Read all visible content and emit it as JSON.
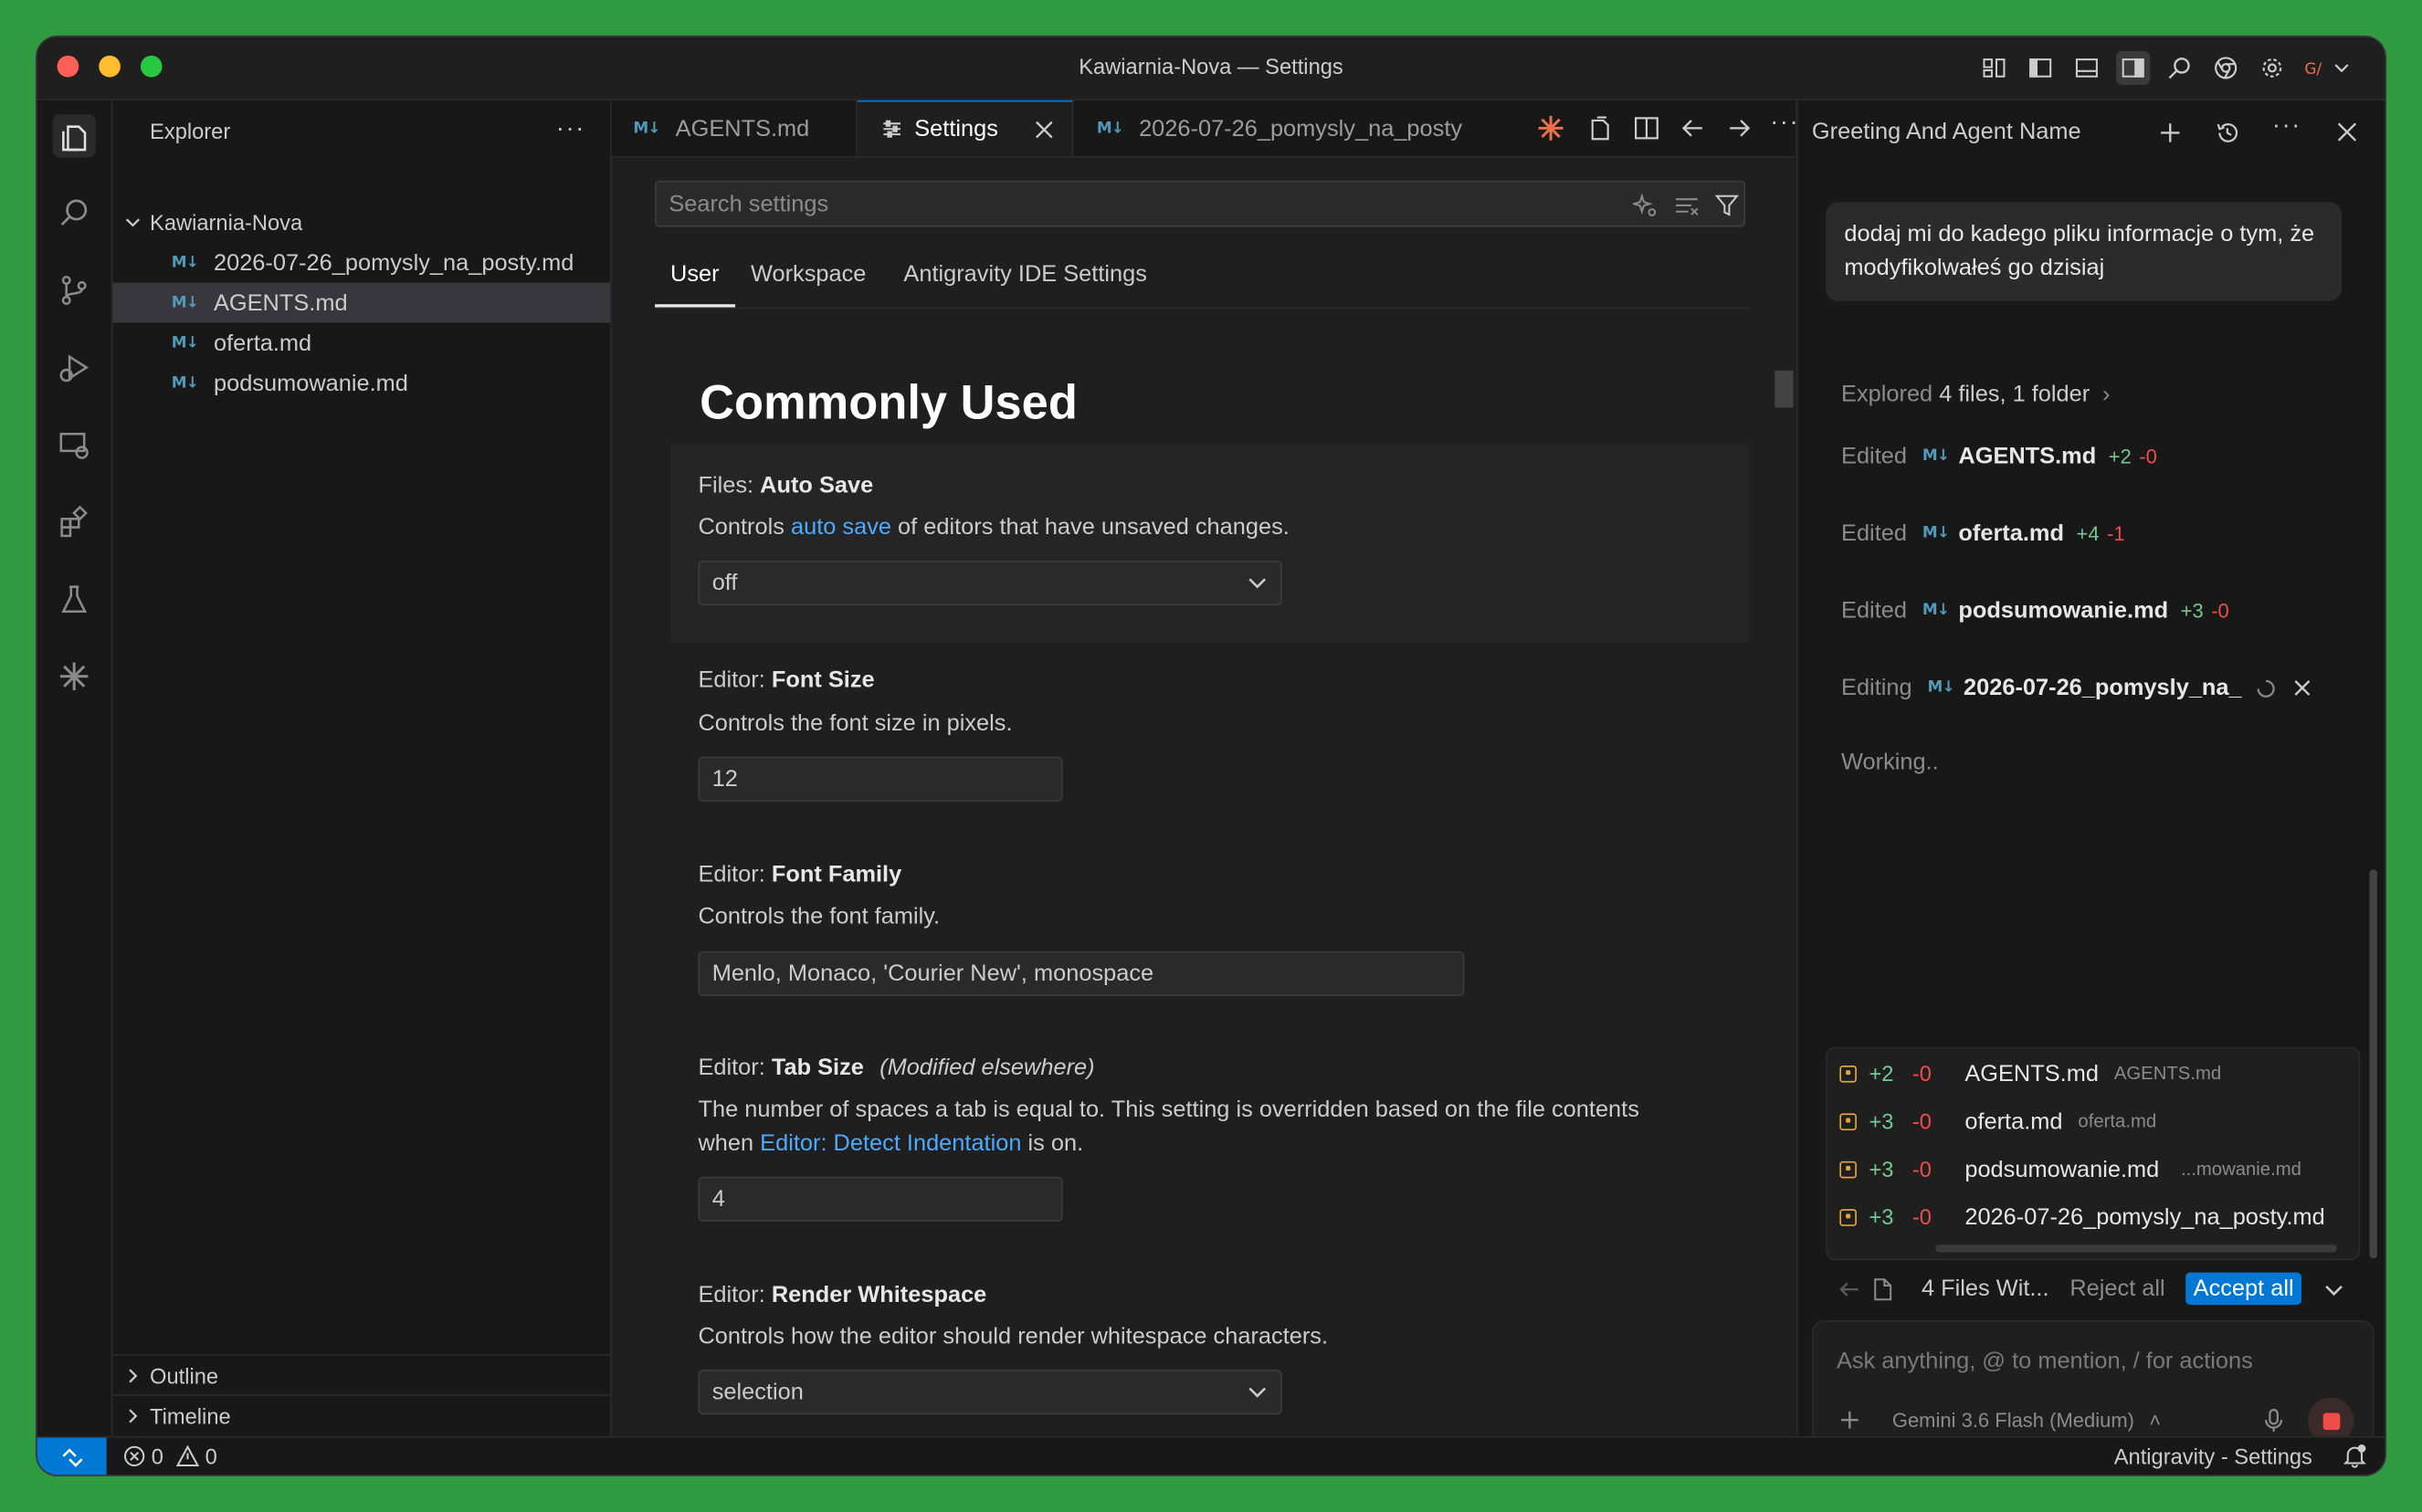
{
  "window": {
    "title": "Kawiarnia-Nova — Settings"
  },
  "explorer": {
    "title": "Explorer",
    "folder": "Kawiarnia-Nova",
    "files": [
      {
        "name": "2026-07-26_pomysly_na_posty.md",
        "icon": "M↓"
      },
      {
        "name": "AGENTS.md",
        "icon": "M↓"
      },
      {
        "name": "oferta.md",
        "icon": "M↓"
      },
      {
        "name": "podsumowanie.md",
        "icon": "M↓"
      }
    ],
    "sections": [
      "Outline",
      "Timeline"
    ]
  },
  "tabs": [
    {
      "label": "AGENTS.md"
    },
    {
      "label": "Settings"
    },
    {
      "label": "2026-07-26_pomysly_na_posty"
    }
  ],
  "settings": {
    "search_placeholder": "Search settings",
    "scope_tabs": [
      "User",
      "Workspace",
      "Antigravity IDE Settings"
    ],
    "section_title": "Commonly Used",
    "items": [
      {
        "category": "Files:",
        "name": "Auto Save",
        "desc_pre": "Controls ",
        "desc_link": "auto save",
        "desc_post": " of editors that have unsaved changes.",
        "value": "off"
      },
      {
        "category": "Editor:",
        "name": "Font Size",
        "desc": "Controls the font size in pixels.",
        "value": "12"
      },
      {
        "category": "Editor:",
        "name": "Font Family",
        "desc": "Controls the font family.",
        "value": "Menlo, Monaco, 'Courier New', monospace"
      },
      {
        "category": "Editor:",
        "name": "Tab Size",
        "modified": "(Modified elsewhere)",
        "desc_line1": "The number of spaces a tab is equal to. This setting is overridden based on the file contents",
        "desc_pre": "when ",
        "desc_link": "Editor: Detect Indentation",
        "desc_post": " is on.",
        "value": "4"
      },
      {
        "category": "Editor:",
        "name": "Render Whitespace",
        "desc": "Controls how the editor should render whitespace characters.",
        "value": "selection"
      }
    ]
  },
  "agent": {
    "title": "Greeting And Agent Name",
    "user_message": "dodaj mi do kadego pliku informacje o tym, że modyfikolwałeś go dzisiaj",
    "explored": {
      "verb": "Explored",
      "detail": "4 files, 1 folder"
    },
    "edits": [
      {
        "verb": "Edited",
        "file": "AGENTS.md",
        "add": "+2",
        "del": "-0"
      },
      {
        "verb": "Edited",
        "file": "oferta.md",
        "add": "+4",
        "del": "-1"
      },
      {
        "verb": "Edited",
        "file": "podsumowanie.md",
        "add": "+3",
        "del": "-0"
      }
    ],
    "editing": {
      "verb": "Editing",
      "file": "2026-07-26_pomysly_na_"
    },
    "working": "Working..",
    "changes": [
      {
        "add": "+2",
        "del": "-0",
        "file": "AGENTS.md",
        "path": "AGENTS.md"
      },
      {
        "add": "+3",
        "del": "-0",
        "file": "oferta.md",
        "path": "oferta.md"
      },
      {
        "add": "+3",
        "del": "-0",
        "file": "podsumowanie.md",
        "path": "...mowanie.md"
      },
      {
        "add": "+3",
        "del": "-0",
        "file": "2026-07-26_pomysly_na_posty.md",
        "path": ""
      }
    ],
    "files_summary": "4 Files Wit...",
    "reject_all": "Reject all",
    "accept_all": "Accept all",
    "input_placeholder": "Ask anything, @ to mention, / for actions",
    "model": "Gemini 3.6 Flash (Medium)"
  },
  "status": {
    "errors": "0",
    "warnings": "0",
    "right_label": "Antigravity - Settings"
  },
  "colors": {
    "accent": "#0078d4",
    "background": "#1f1f1f",
    "sidebar": "#181818",
    "link": "#4daafc",
    "added": "#73c991",
    "removed": "#f14c4c"
  }
}
